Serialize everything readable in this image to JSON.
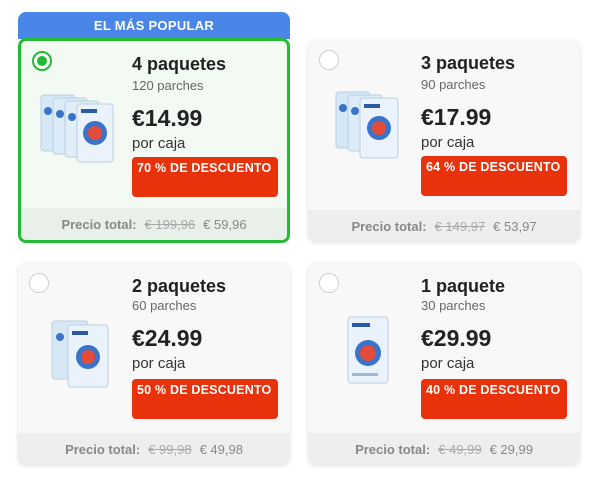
{
  "popular_label": "EL MÁS POPULAR",
  "colors": {
    "accent_green": "#22bb33",
    "banner_blue": "#4a86e8",
    "discount_red": "#e8320c"
  },
  "offers": [
    {
      "title": "4 paquetes",
      "subtitle": "120 parches",
      "price": "€14.99",
      "per_box": "por caja",
      "discount": "70 % DE DESCUENTO",
      "total_label": "Precio total:",
      "old_total": "€ 199,96",
      "new_total": "€ 59,96",
      "selected": true,
      "image_icon": "patch-box-stack-4-icon"
    },
    {
      "title": "3 paquetes",
      "subtitle": "90 parches",
      "price": "€17.99",
      "per_box": "por caja",
      "discount": "64 % DE DESCUENTO",
      "total_label": "Precio total:",
      "old_total": "€ 149,97",
      "new_total": "€ 53,97",
      "selected": false,
      "image_icon": "patch-box-stack-3-icon"
    },
    {
      "title": "2 paquetes",
      "subtitle": "60 parches",
      "price": "€24.99",
      "per_box": "por caja",
      "discount": "50 % DE DESCUENTO",
      "total_label": "Precio total:",
      "old_total": "€ 99,98",
      "new_total": "€ 49,98",
      "selected": false,
      "image_icon": "patch-box-stack-2-icon"
    },
    {
      "title": "1 paquete",
      "subtitle": "30 parches",
      "price": "€29.99",
      "per_box": "por caja",
      "discount": "40 % DE DESCUENTO",
      "total_label": "Precio total:",
      "old_total": "€ 49,99",
      "new_total": "€ 29,99",
      "selected": false,
      "image_icon": "patch-box-single-icon"
    }
  ]
}
